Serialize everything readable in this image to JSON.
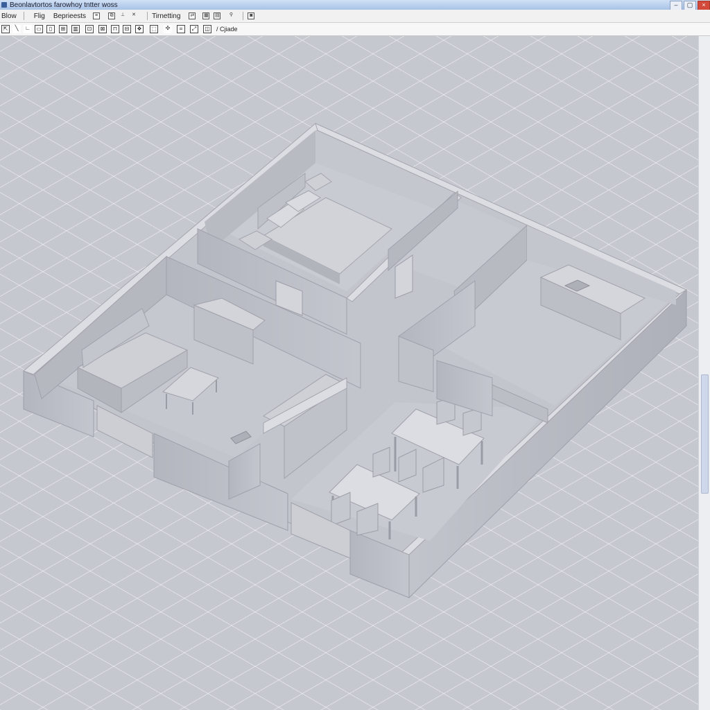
{
  "window": {
    "title": "Beonlavtortos farowhoy tntter woss",
    "controls": [
      "–",
      "▢",
      "×"
    ]
  },
  "menu": {
    "items": [
      "Blow",
      "Flig",
      "Beprieests",
      "Tirnetting"
    ]
  },
  "toolbar": {
    "label": "/ Cjiade"
  },
  "colors": {
    "title_bar": "#b9cfee",
    "grid_background": "#c6c8d0",
    "model_wall": "#b7b9c2",
    "model_floor": "#c0c2ca",
    "close_button": "#d44a3a"
  },
  "icons": {
    "axis": "xyz-axis-icon",
    "close": "close-icon",
    "maximize": "maximize-icon",
    "minimize": "minimize-icon"
  }
}
